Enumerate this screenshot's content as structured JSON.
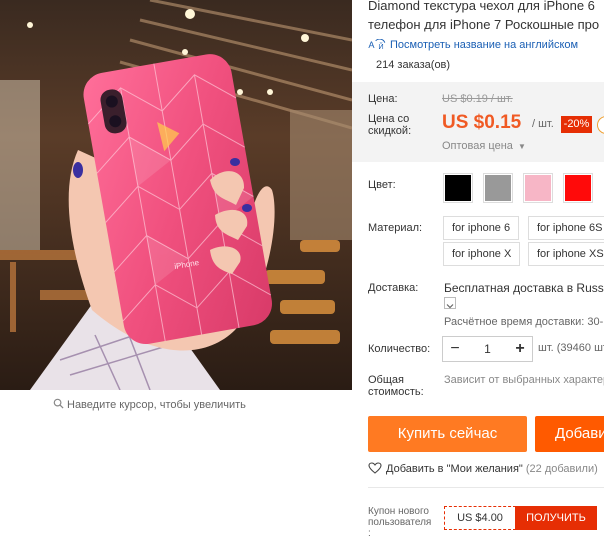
{
  "product": {
    "title_line1": "Diamond текстура чехол для iPhone 6",
    "title_line2": "телефон для iPhone 7 Роскошные про",
    "translate_link": "Посмотреть название на английском",
    "orders": "214 заказа(ов)"
  },
  "image": {
    "zoom_hint": "Наведите курсор, чтобы увеличить"
  },
  "price": {
    "price_label": "Цена:",
    "old_price": "US $0.19 / шт.",
    "discount_label_1": "Цена со",
    "discount_label_2": "скидкой:",
    "new_price": "US $0.15",
    "unit": "/ шт.",
    "discount": "-20%",
    "wholesale": "Оптовая цена"
  },
  "color": {
    "label": "Цвет:",
    "swatches": [
      {
        "name": "black",
        "hex": "#000000"
      },
      {
        "name": "gray",
        "hex": "#999999"
      },
      {
        "name": "pink",
        "hex": "#f7b6c6"
      },
      {
        "name": "red",
        "hex": "#ff0a0a"
      }
    ]
  },
  "material": {
    "label": "Материал:",
    "options": [
      "for iphone 6",
      "for iphone 6S",
      "for iphone X",
      "for iphone XS"
    ]
  },
  "shipping": {
    "label": "Доставка:",
    "text": "Бесплатная доставка в Russian",
    "estimate": "Расчётное время доставки: 30-"
  },
  "quantity": {
    "label": "Количество:",
    "minus": "−",
    "value": "1",
    "plus": "+",
    "note": "шт. (39460 шт"
  },
  "total": {
    "label_1": "Общая",
    "label_2": "стоимость:",
    "note": "Зависит от выбранных характер"
  },
  "actions": {
    "buy_now": "Купить сейчас",
    "add_to_cart": "Добавить"
  },
  "wishlist": {
    "text": "Добавить в \"Мои желания\"",
    "count": "(22 добавили)"
  },
  "coupon": {
    "label_1": "Купон нового",
    "label_2": "пользователя",
    "label_3": ":",
    "value": "US $4.00",
    "button": "ПОЛУЧИТЬ"
  },
  "colors": {
    "accent_orange": "#ff7a22",
    "price_red": "#f05a24",
    "badge_red": "#e62e04",
    "link_blue": "#1a5fb4"
  }
}
